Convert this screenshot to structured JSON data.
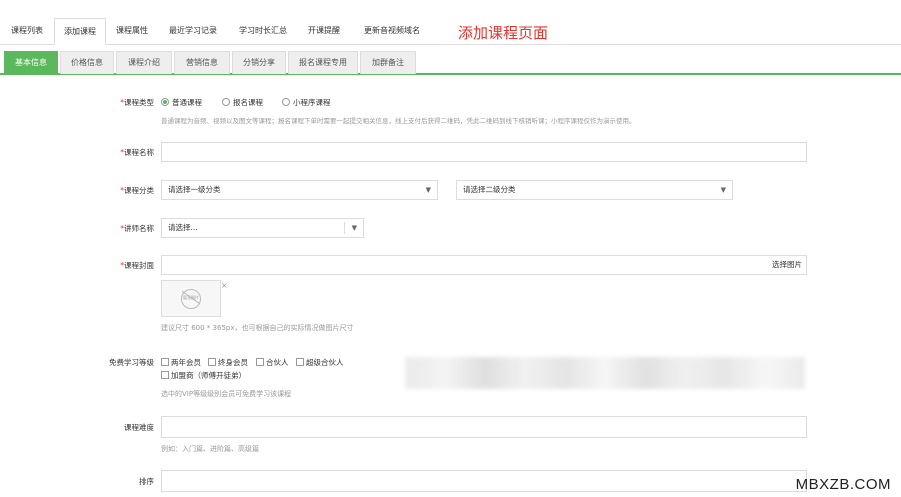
{
  "top_tabs": [
    "课程列表",
    "添加课程",
    "课程属性",
    "最近学习记录",
    "学习时长汇总",
    "开课提醒",
    "更新音视频域名"
  ],
  "annotation": "添加课程页面",
  "sub_tabs": [
    "基本信息",
    "价格信息",
    "课程介绍",
    "营销信息",
    "分销分享",
    "报名课程专用",
    "加群备注"
  ],
  "form": {
    "course_type": {
      "label": "课程类型",
      "options": [
        "普通课程",
        "报名课程",
        "小程序课程"
      ],
      "selected_index": 0,
      "hint": "普通课程为音频、视频以及图文等课程；报名课程下单时需要一起提交相关信息，线上支付后获得二维码，凭此二维码到线下核销听课；小程序课程仅作为演示使用。"
    },
    "course_name": {
      "label": "课程名称",
      "value": ""
    },
    "course_category": {
      "label": "课程分类",
      "first_placeholder": "请选择一级分类",
      "second_placeholder": "请选择二级分类"
    },
    "teacher": {
      "label": "讲师名称",
      "placeholder": "请选择..."
    },
    "cover": {
      "label": "课程封面",
      "button": "选择图片",
      "thumb_text": "暂无图片",
      "close": "×",
      "hint": "建议尺寸 600 * 365px，也可根据自己的实际情况做图片尺寸"
    },
    "free_level": {
      "label": "免费学习等级",
      "options": [
        "两年会员",
        "终身会员",
        "合伙人",
        "超级合伙人",
        "加盟商（师傅开徒弟）"
      ],
      "hint": "选中的VIP等级级别会员可免费学习该课程"
    },
    "difficulty": {
      "label": "课程难度",
      "hint": "例如：入门篇、进阶篇、高级篇"
    },
    "sort": {
      "label": "排序"
    }
  },
  "required_mark": "*",
  "watermark": "MBXZB.COM",
  "colors": {
    "accent": "#5cb85c",
    "annotation": "#e8322c"
  },
  "icons": {
    "caret": "chevron-down-icon",
    "close": "close-icon",
    "placeholder_image": "no-image-icon"
  }
}
